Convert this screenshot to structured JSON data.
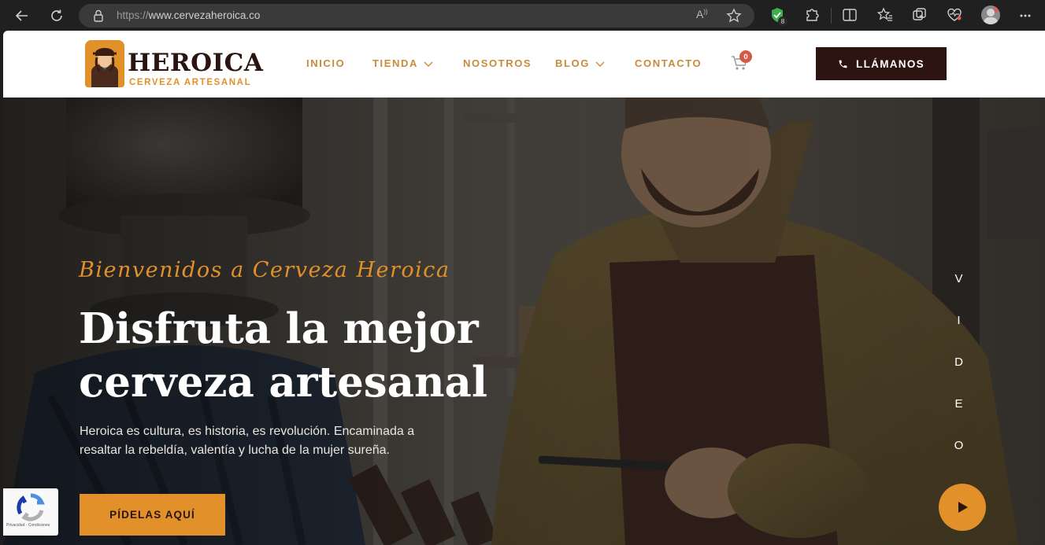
{
  "browser": {
    "url_scheme": "https://",
    "url_host": "www.cervezaheroica.co",
    "read_aloud_label": "A",
    "extension_badge": "8"
  },
  "header": {
    "logo_title": "HEROICA",
    "logo_subtitle": "CERVEZA ARTESANAL",
    "nav": {
      "inicio": "INICIO",
      "tienda": "TIENDA",
      "nosotros": "NOSOTROS",
      "blog": "BLOG",
      "contacto": "CONTACTO"
    },
    "cart_count": "0",
    "call_label": "LLÁMANOS"
  },
  "hero": {
    "welcome": "Bienvenidos a Cerveza Heroica",
    "headline_line1": "Disfruta la mejor",
    "headline_line2": "cerveza artesanal",
    "lede": "Heroica es cultura, es historia, es revolución. Encaminada a resaltar la rebeldía, valentía y lucha de la mujer sureña.",
    "cta_label": "PÍDELAS AQUÍ",
    "video_letters": [
      "V",
      "I",
      "D",
      "E",
      "O"
    ]
  },
  "recaptcha": {
    "footer_text": "Privacidad - Condiciones"
  },
  "colors": {
    "brand_orange": "#e2902a",
    "brand_dark": "#2e1410",
    "nav_text": "#c98a3c",
    "cart_badge": "#d45a48"
  },
  "icons": [
    "back-icon",
    "refresh-icon",
    "lock-icon",
    "star-icon",
    "shield-extension-icon",
    "puzzle-icon",
    "split-screen-icon",
    "favorites-icon",
    "collections-icon",
    "heart-pulse-icon",
    "profile-avatar",
    "more-icon",
    "cart-icon",
    "phone-icon",
    "play-icon",
    "recaptcha-icon"
  ]
}
